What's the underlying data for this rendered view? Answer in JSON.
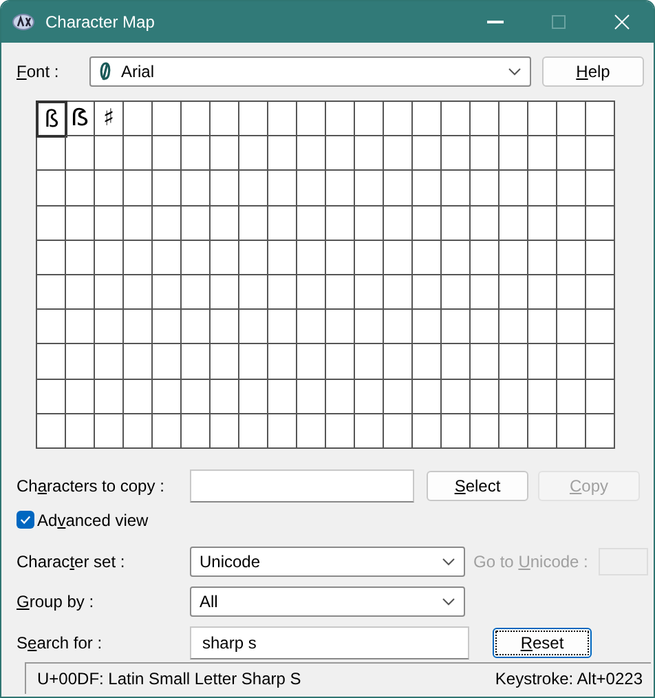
{
  "window": {
    "title": "Character Map"
  },
  "font": {
    "label": {
      "key": "F",
      "after": "ont :"
    },
    "value": "Arial"
  },
  "help_button": {
    "label": {
      "key": "H",
      "after": "elp"
    }
  },
  "grid": {
    "characters": [
      {
        "char": "ß",
        "selected": true
      },
      {
        "char": "ẞ",
        "selected": false
      },
      {
        "char": "♯",
        "selected": false
      }
    ]
  },
  "characters_to_copy": {
    "label": {
      "before": "Ch",
      "key": "a",
      "after": "racters to copy :"
    }
  },
  "select_button": {
    "label": {
      "key": "S",
      "after": "elect"
    },
    "disabled": false
  },
  "copy_button": {
    "label": {
      "key": "C",
      "after": "opy"
    },
    "disabled": true
  },
  "advanced_view": {
    "label": {
      "before": "Ad",
      "key": "v",
      "after": "anced view"
    },
    "checked": true
  },
  "character_set": {
    "label": {
      "before": "Charac",
      "key": "t",
      "after": "er set :"
    },
    "value": "Unicode"
  },
  "go_to_unicode": {
    "label": {
      "before": "Go to ",
      "key": "U",
      "after": "nicode :"
    },
    "disabled": true
  },
  "group_by": {
    "label": {
      "key": "G",
      "after": "roup by :"
    },
    "value": "All"
  },
  "search_for": {
    "label": {
      "before": "S",
      "key": "e",
      "after": "arch for :"
    },
    "value": "sharp s"
  },
  "reset_button": {
    "label": {
      "key": "R",
      "after": "eset"
    },
    "disabled": false
  },
  "status_bar": {
    "description": "U+00DF: Latin Small Letter Sharp S",
    "keystroke": "Keystroke: Alt+0223"
  }
}
